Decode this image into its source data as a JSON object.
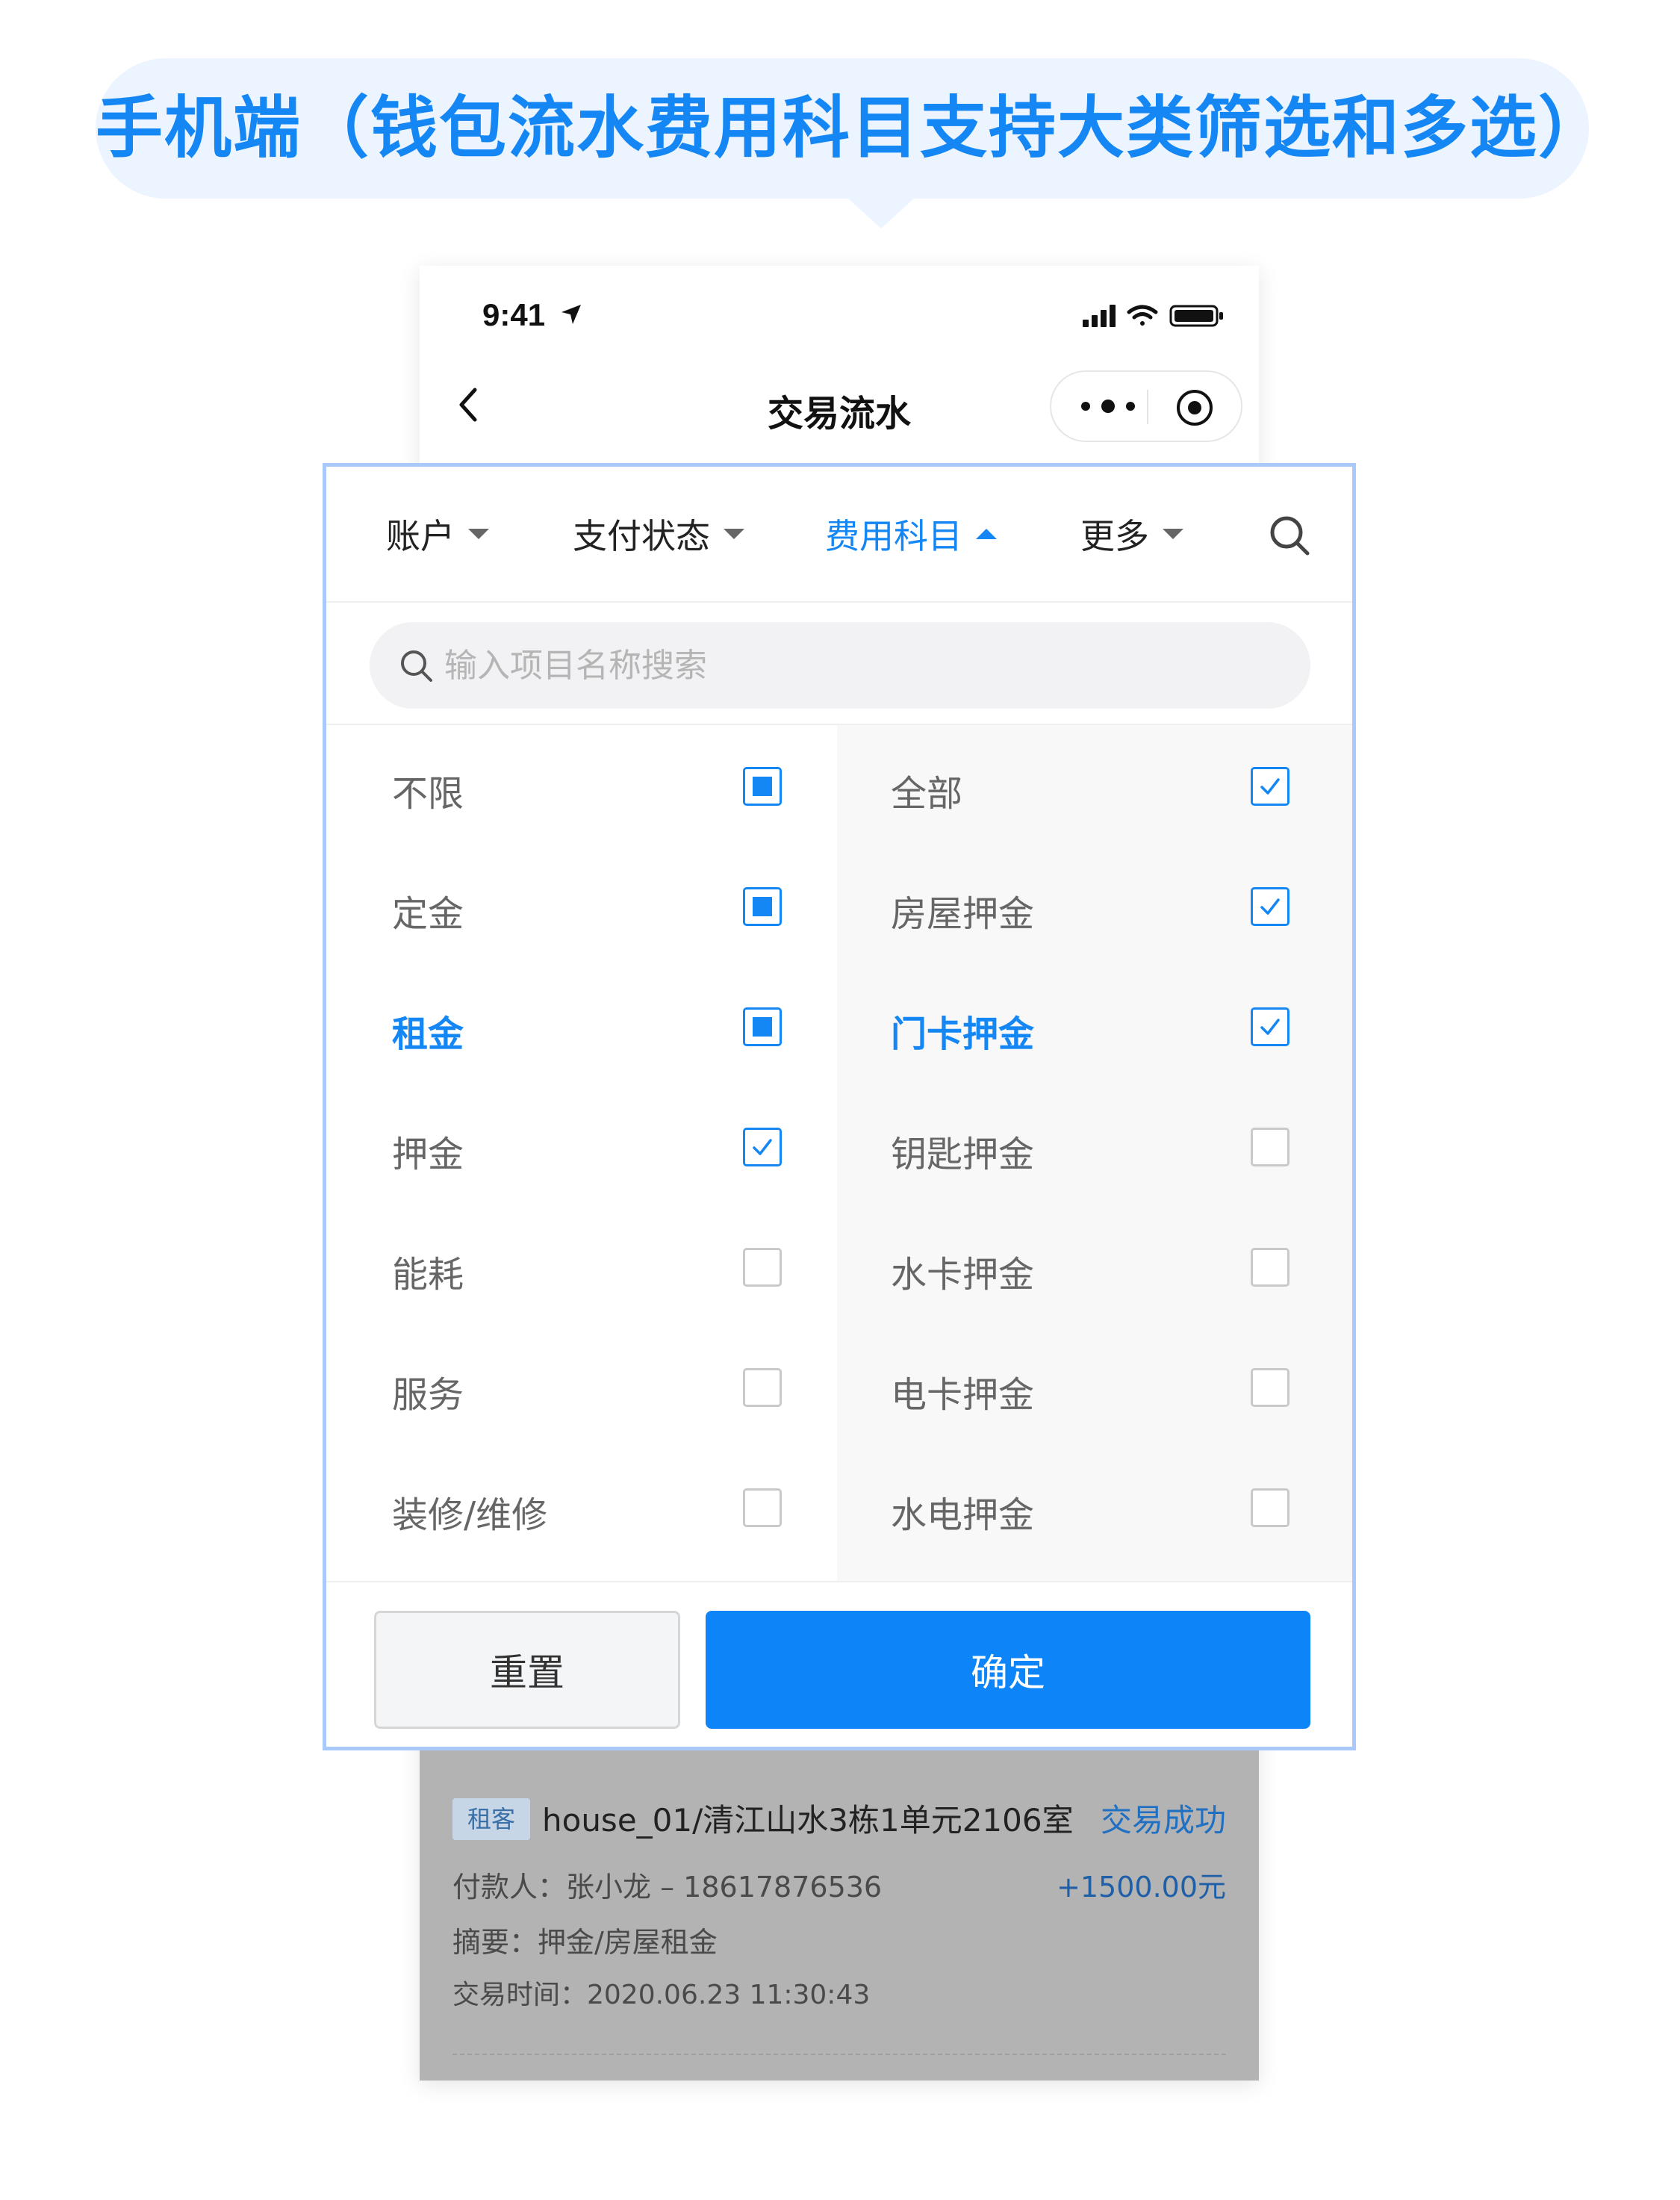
{
  "banner": {
    "title": "手机端（钱包流水费用科目支持大类筛选和多选）"
  },
  "status_bar": {
    "time": "9:41"
  },
  "nav": {
    "title": "交易流水"
  },
  "filter_tabs": [
    {
      "label": "账户",
      "active": false
    },
    {
      "label": "支付状态",
      "active": false
    },
    {
      "label": "费用科目",
      "active": true
    },
    {
      "label": "更多",
      "active": false
    }
  ],
  "search": {
    "placeholder": "输入项目名称搜索",
    "value": ""
  },
  "categories": [
    {
      "label": "不限",
      "state": "partial",
      "active": false
    },
    {
      "label": "定金",
      "state": "partial",
      "active": false
    },
    {
      "label": "租金",
      "state": "partial",
      "active": true
    },
    {
      "label": "押金",
      "state": "checked",
      "active": false
    },
    {
      "label": "能耗",
      "state": "unchecked",
      "active": false
    },
    {
      "label": "服务",
      "state": "unchecked",
      "active": false
    },
    {
      "label": "装修/维修",
      "state": "unchecked",
      "active": false
    }
  ],
  "subcategories": [
    {
      "label": "全部",
      "state": "checked",
      "active": false
    },
    {
      "label": "房屋押金",
      "state": "checked",
      "active": false
    },
    {
      "label": "门卡押金",
      "state": "checked",
      "active": true
    },
    {
      "label": "钥匙押金",
      "state": "unchecked",
      "active": false
    },
    {
      "label": "水卡押金",
      "state": "unchecked",
      "active": false
    },
    {
      "label": "电卡押金",
      "state": "unchecked",
      "active": false
    },
    {
      "label": "水电押金",
      "state": "unchecked",
      "active": false
    }
  ],
  "buttons": {
    "reset": "重置",
    "confirm": "确定"
  },
  "transaction": {
    "tag": "租客",
    "house": "house_01/清江山水3栋1单元2106室",
    "status": "交易成功",
    "payer": "付款人：张小龙 – 18617876536",
    "amount": "+1500.00元",
    "summary": "摘要：押金/房屋租金",
    "time": "交易时间：2020.06.23  11:30:43"
  },
  "colors": {
    "accent": "#1487f5",
    "panel_border": "#a9c9fb",
    "banner_bg": "#ecf5ff",
    "overlay": "#b3b3b3"
  }
}
